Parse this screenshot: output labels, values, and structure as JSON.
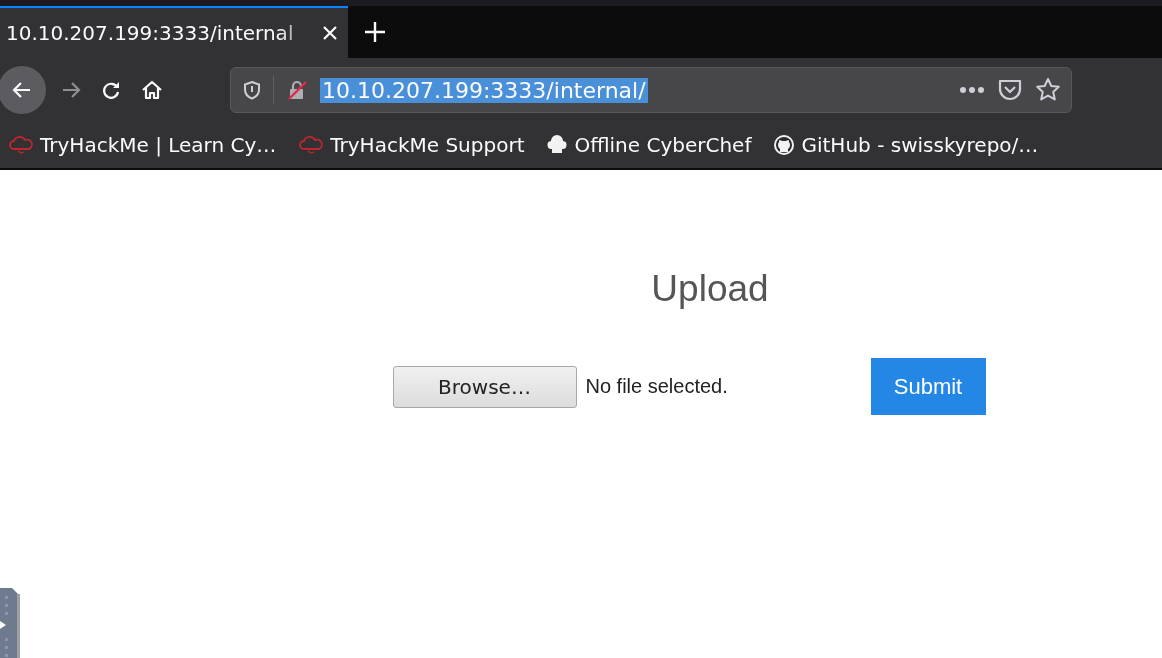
{
  "tabs": [
    {
      "title": "10.10.207.199:3333/internal",
      "selected": true
    }
  ],
  "address_bar": {
    "url": "10.10.207.199:3333/internal/",
    "selected": true
  },
  "bookmarks": [
    {
      "label": "TryHackMe | Learn Cy…",
      "kind": "cloud"
    },
    {
      "label": "TryHackMe Support",
      "kind": "cloud"
    },
    {
      "label": "Offline CyberChef",
      "kind": "chef"
    },
    {
      "label": "GitHub - swisskyrepo/…",
      "kind": "github"
    }
  ],
  "page": {
    "heading": "Upload",
    "file_input": {
      "button": "Browse…",
      "status": "No file selected."
    },
    "submit": "Submit"
  }
}
